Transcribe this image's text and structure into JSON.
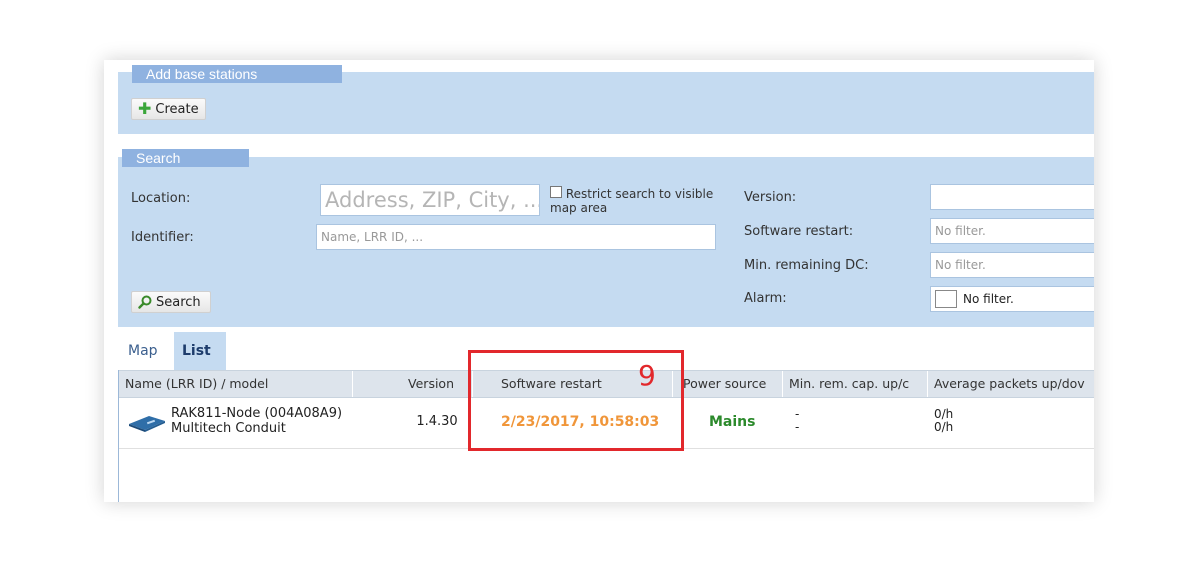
{
  "add_panel": {
    "title": "Add base stations",
    "create_label": "Create"
  },
  "search_panel": {
    "title": "Search",
    "location_label": "Location:",
    "location_placeholder": "Address, ZIP, City, ...",
    "restrict_label": "Restrict search to visible map area",
    "identifier_label": "Identifier:",
    "identifier_placeholder": "Name, LRR ID, ...",
    "version_label": "Version:",
    "version_value": "",
    "software_restart_label": "Software restart:",
    "software_restart_value": "No filter.",
    "min_remaining_label": "Min. remaining DC:",
    "min_remaining_value": "No filter.",
    "alarm_label": "Alarm:",
    "alarm_value": "No filter.",
    "search_button": "Search"
  },
  "tabs": [
    {
      "label": "Map",
      "active": false
    },
    {
      "label": "List",
      "active": true
    }
  ],
  "table": {
    "columns": [
      "Name (LRR ID) / model",
      "Version",
      "Software restart",
      "Power source",
      "Min. rem. cap. up/c",
      "Average packets up/dov"
    ],
    "rows": [
      {
        "name": "RAK811-Node (004A08A9)",
        "model": "Multitech Conduit",
        "version": "1.4.30",
        "software_restart": "2/23/2017, 10:58:03",
        "power_source": "Mains",
        "min_rem_up": "-",
        "min_rem_down": "-",
        "avg_up": "0/h",
        "avg_down": "0/h"
      }
    ]
  },
  "annotation": {
    "marker": "9"
  },
  "colors": {
    "panel_bg": "#c5dbf1",
    "legend_bg": "#8fb2e0",
    "restart_orange": "#f0963a",
    "mains_green": "#2c8a2c",
    "highlight_red": "#e2282c"
  },
  "icons": {
    "create": "plus-icon",
    "search": "magnifier-icon",
    "device": "gateway-device-icon"
  }
}
